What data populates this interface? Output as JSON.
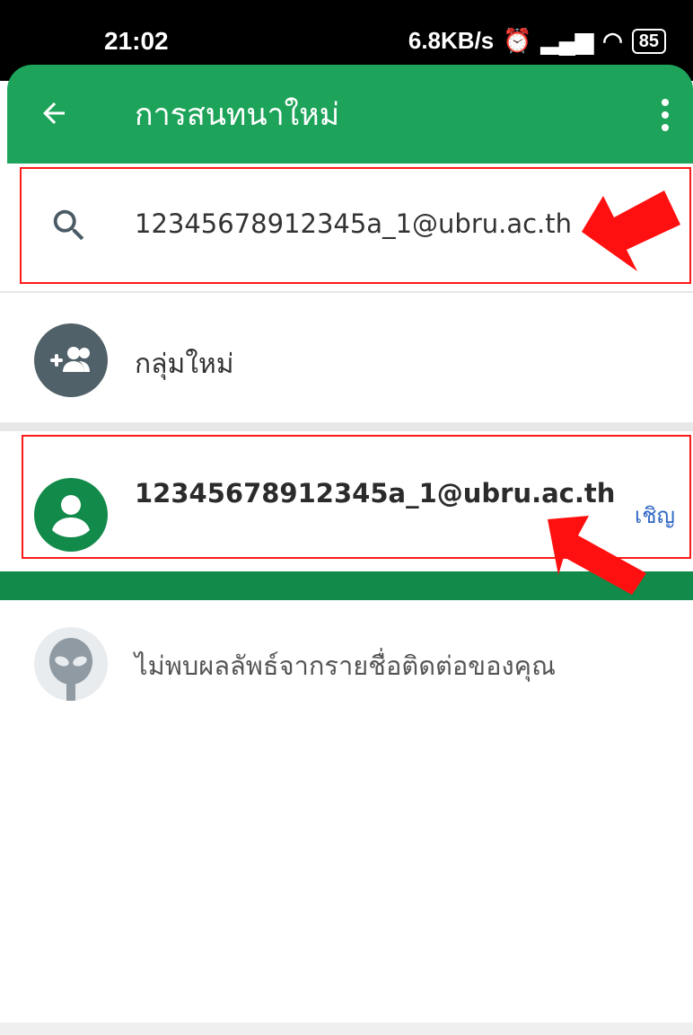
{
  "status": {
    "time": "21:02",
    "speed": "6.8KB/s",
    "battery": "85"
  },
  "header": {
    "title": "การสนทนาใหม่"
  },
  "search": {
    "value": "12345678912345a_1@ubru.ac.th"
  },
  "list": {
    "new_group_label": "กลุ่มใหม่",
    "contact_email": "12345678912345a_1@ubru.ac.th",
    "invite_label": "เชิญ",
    "no_results_text": "ไม่พบผลลัพธ์จากรายชื่อติดต่อของคุณ"
  },
  "colors": {
    "accent_green": "#1ea45a",
    "dark_green": "#118a4a",
    "highlight_red": "#ff1a1a",
    "link_blue": "#2f66c4"
  },
  "icons": [
    "back-arrow-icon",
    "more-vert-icon",
    "search-icon",
    "group-add-icon",
    "person-icon",
    "alien-icon"
  ]
}
